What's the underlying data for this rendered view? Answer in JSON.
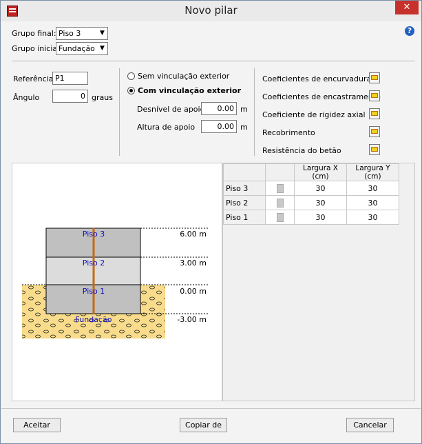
{
  "window": {
    "title": "Novo pilar",
    "close": "✕",
    "help": "?"
  },
  "group": {
    "final_label": "Grupo final:",
    "final_value": "Piso 3",
    "initial_label": "Grupo inicial:",
    "initial_value": "Fundação"
  },
  "props": {
    "ref_label": "Referência",
    "ref_value": "P1",
    "angle_label": "Ângulo",
    "angle_value": "0",
    "angle_unit": "graus"
  },
  "binding": {
    "without_label": "Sem vinculação exterior",
    "with_label": "Com vinculação exterior",
    "selected": "with",
    "offset_label": "Desnível de apoio",
    "offset_value": "0.00",
    "offset_unit": "m",
    "height_label": "Altura de apoio",
    "height_value": "0.00",
    "height_unit": "m"
  },
  "coef": {
    "buckling": "Coeficientes de encurvadura",
    "fixity": "Coeficientes de encastramento",
    "axial": "Coeficiente de rigidez axial",
    "cover": "Recobrimento",
    "concrete": "Resistência do betão"
  },
  "diagram": {
    "floors": [
      "Piso 3",
      "Piso 2",
      "Piso 1",
      "Fundação"
    ],
    "levels": [
      "6.00 m",
      "3.00 m",
      "0.00 m",
      "-3.00 m"
    ],
    "colors": {
      "floor_dark": "#c0c0c0",
      "floor_light": "#dcdcdc",
      "soil": "#f8dc8c",
      "column": "#c46a10",
      "label": "#1010c0"
    }
  },
  "table": {
    "headers": [
      "",
      "",
      "Largura X (cm)",
      "Largura Y (cm)"
    ],
    "rows": [
      {
        "name": "Piso 3",
        "x": "30",
        "y": "30"
      },
      {
        "name": "Piso 2",
        "x": "30",
        "y": "30"
      },
      {
        "name": "Piso 1",
        "x": "30",
        "y": "30"
      }
    ]
  },
  "buttons": {
    "accept": "Aceitar",
    "copy": "Copiar de",
    "cancel": "Cancelar"
  }
}
